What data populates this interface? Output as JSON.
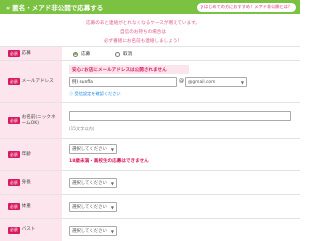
{
  "header": {
    "title": "匿名・メアド非公開で応募する",
    "chevron": "«",
    "help": "はじめての方におすすめ！メアド非公開とは？",
    "help_icon": "?"
  },
  "notice": [
    "応募のあと連絡がとれなくなるケースが増えています。",
    "自信のお持ちの場合は",
    "必ず番組にお名前も連絡しましょう！"
  ],
  "required_badge": "必須",
  "form": {
    "application": {
      "label": "応募",
      "options": [
        "応募",
        "取消"
      ]
    },
    "email": {
      "label": "メールアドレス",
      "warning": "安心♪お店にメールアドレスは公開されません",
      "local_value": "例) sunfla",
      "at": "@",
      "domain_value": "@gmail.com",
      "hint": "受信設定を確認ください"
    },
    "nickname": {
      "label": "お名前(ニックネームOK)",
      "value": "",
      "note": "(15文字以内)"
    },
    "age": {
      "label": "年齢",
      "select": "選択してください",
      "warning": "18歳未満・高校生の応募はできません"
    },
    "height": {
      "label": "身長",
      "select": "選択してください"
    },
    "weight": {
      "label": "体重",
      "select": "選択してください"
    },
    "bust": {
      "label": "バスト",
      "select": "選択してください"
    }
  }
}
